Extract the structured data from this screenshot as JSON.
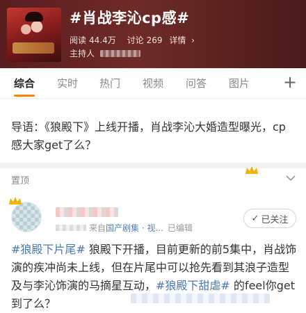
{
  "header": {
    "title": "#肖战李沁cp感#",
    "reads_label": "阅读",
    "reads_value": "44.4万",
    "discuss_label": "讨论",
    "discuss_value": "269",
    "detail_label": "详情",
    "host_label": "主持人"
  },
  "tabs": [
    {
      "label": "综合",
      "active": true
    },
    {
      "label": "实时"
    },
    {
      "label": "热门"
    },
    {
      "label": "视频"
    },
    {
      "label": "问答"
    },
    {
      "label": "图片"
    }
  ],
  "intro": {
    "text": "导语：《狼殿下》上线开播，肖战李沁大婚造型曝光，cp感大家get了么？"
  },
  "pinned": {
    "label": "置顶"
  },
  "post": {
    "meta_source_prefix": "来自",
    "meta_source": "国产剧集 · 视...",
    "meta_edited": "已编辑",
    "follow_label": "已关注",
    "content": [
      {
        "text": "#狼殿下片尾#",
        "type": "topic"
      },
      {
        "text": " 狼殿下开播，目前更新的前5集中，肖战饰演的疾冲尚未上线，但在片尾中可以抢先看到其浪子造型及与李沁饰演的马摘星互动，",
        "type": "text"
      },
      {
        "text": "#狼殿下甜虐#",
        "type": "topic"
      },
      {
        "text": " 的feel你get到了么？",
        "type": "text"
      }
    ]
  },
  "colors": {
    "accent": "#ff8200",
    "topic": "#4a78b8",
    "header_bg": "#5a1d1f"
  }
}
